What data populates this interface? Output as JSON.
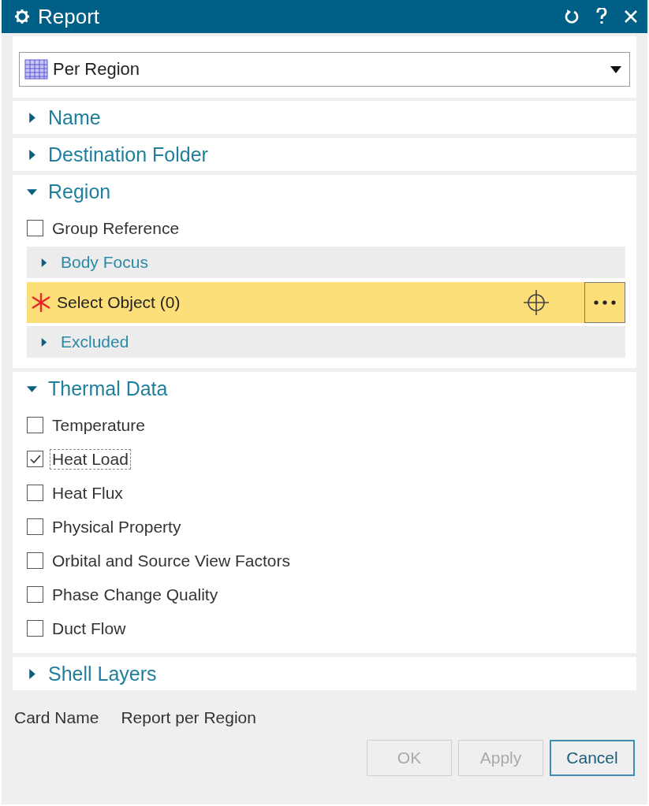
{
  "window": {
    "title": "Report"
  },
  "type_selector": {
    "value": "Per Region"
  },
  "sections": [
    {
      "title": "Name",
      "expanded": false
    },
    {
      "title": "Destination Folder",
      "expanded": false
    },
    {
      "title": "Region",
      "expanded": true,
      "items": [
        {
          "kind": "checkbox",
          "label": "Group Reference",
          "checked": false,
          "focused": false
        },
        {
          "kind": "subsection",
          "label": "Body Focus"
        },
        {
          "kind": "selection",
          "label": "Select Object (0)"
        },
        {
          "kind": "subsection",
          "label": "Excluded"
        }
      ]
    },
    {
      "title": "Thermal Data",
      "expanded": true,
      "items": [
        {
          "kind": "checkbox",
          "label": "Temperature",
          "checked": false,
          "focused": false
        },
        {
          "kind": "checkbox",
          "label": "Heat Load",
          "checked": true,
          "focused": true
        },
        {
          "kind": "checkbox",
          "label": "Heat Flux",
          "checked": false,
          "focused": false
        },
        {
          "kind": "checkbox",
          "label": "Physical Property",
          "checked": false,
          "focused": false
        },
        {
          "kind": "checkbox",
          "label": "Orbital and Source View Factors",
          "checked": false,
          "focused": false
        },
        {
          "kind": "checkbox",
          "label": "Phase Change Quality",
          "checked": false,
          "focused": false
        },
        {
          "kind": "checkbox",
          "label": "Duct Flow",
          "checked": false,
          "focused": false
        }
      ]
    },
    {
      "title": "Shell Layers",
      "expanded": false
    }
  ],
  "card_name": {
    "label": "Card Name",
    "value": "Report per Region"
  },
  "buttons": [
    {
      "label": "OK",
      "disabled": true
    },
    {
      "label": "Apply",
      "disabled": true
    },
    {
      "label": "Cancel",
      "disabled": false
    }
  ]
}
